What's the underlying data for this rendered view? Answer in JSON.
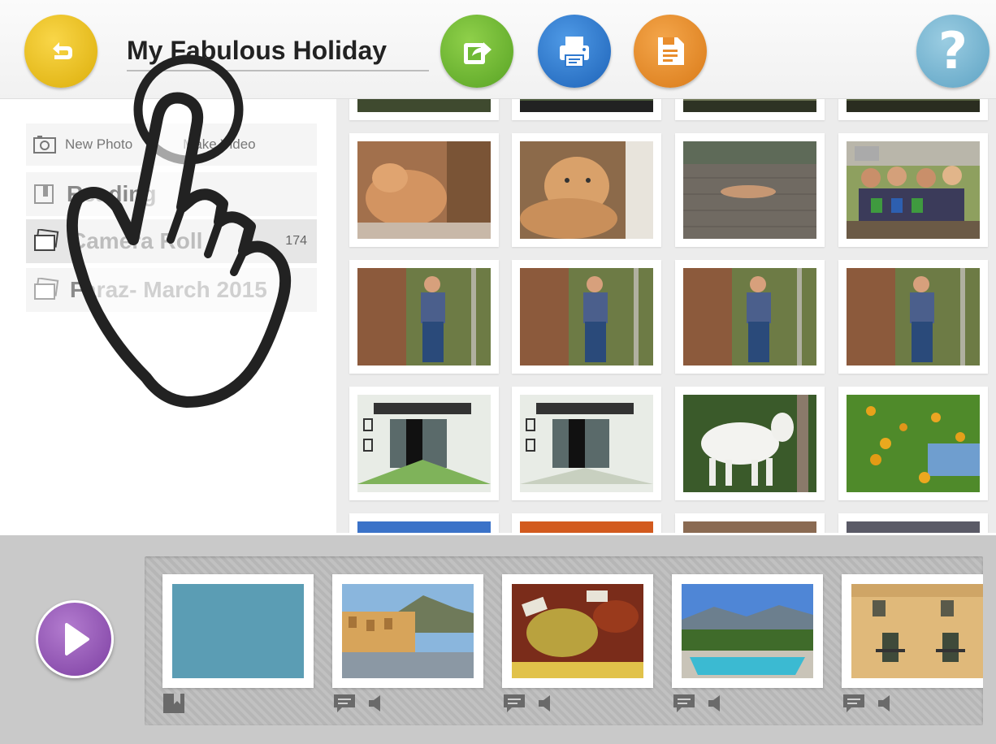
{
  "header": {
    "title": "My Fabulous Holiday",
    "buttons": {
      "back": "back-arrow-icon",
      "share": "share-icon",
      "print": "print-icon",
      "save": "save-icon",
      "help": "help-icon"
    },
    "colors": {
      "back": "#e8be1c",
      "share": "#6fba35",
      "print": "#2f79cf",
      "save": "#e98d2c",
      "help": "#7cb9d6"
    }
  },
  "sidebar": {
    "new_photo_label": "New Photo",
    "make_video_label": "Make Video",
    "items": [
      {
        "label": "Reading",
        "icon": "book-icon"
      },
      {
        "label": "Camera Roll",
        "count": "174",
        "icon": "photo-stack-icon",
        "selected": true
      },
      {
        "label": "Faraz- March 2015",
        "icon": "photo-stack-icon"
      }
    ]
  },
  "photo_grid": {
    "photos": [
      "cat-photo",
      "cat-photo",
      "cat-on-deck-photo",
      "group-of-women-photo",
      "woman-by-tree-photo",
      "woman-by-tree-photo",
      "woman-by-tree-photo",
      "woman-by-tree-photo",
      "sketch-street-photo",
      "sketch-street-photo",
      "white-goat-photo",
      "lemon-tree-photo"
    ]
  },
  "filmstrip": {
    "play_icon": "play-icon",
    "slides": [
      {
        "name": "title-slide",
        "color": "#5b9db4",
        "icons": [
          "bookmark-icon"
        ]
      },
      {
        "name": "coastal-town-slide",
        "icons": [
          "caption-icon",
          "audio-icon"
        ]
      },
      {
        "name": "food-market-slide",
        "icons": [
          "caption-icon",
          "audio-icon"
        ]
      },
      {
        "name": "pool-slide",
        "icons": [
          "caption-icon",
          "audio-icon"
        ]
      },
      {
        "name": "building-slide",
        "icons": [
          "caption-icon",
          "audio-icon"
        ]
      }
    ]
  }
}
